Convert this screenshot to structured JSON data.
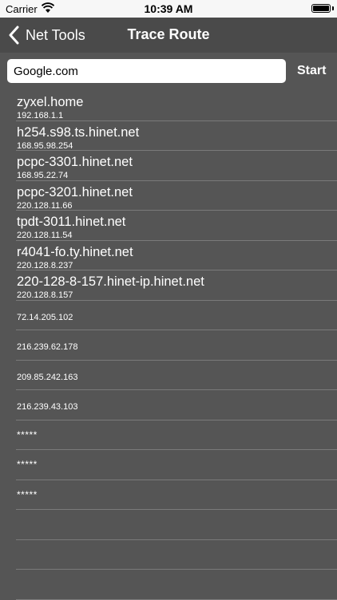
{
  "status_bar": {
    "carrier": "Carrier",
    "time": "10:39 AM"
  },
  "nav": {
    "back_label": "Net Tools",
    "title": "Trace Route"
  },
  "search": {
    "value": "Google.com",
    "start_label": "Start"
  },
  "hops": [
    {
      "host": "zyxel.home",
      "ip": "192.168.1.1"
    },
    {
      "host": "h254.s98.ts.hinet.net",
      "ip": "168.95.98.254"
    },
    {
      "host": "pcpc-3301.hinet.net",
      "ip": "168.95.22.74"
    },
    {
      "host": "pcpc-3201.hinet.net",
      "ip": "220.128.11.66"
    },
    {
      "host": "tpdt-3011.hinet.net",
      "ip": "220.128.11.54"
    },
    {
      "host": "r4041-fo.ty.hinet.net",
      "ip": "220.128.8.237"
    },
    {
      "host": "220-128-8-157.hinet-ip.hinet.net",
      "ip": "220.128.8.157"
    },
    {
      "host": "",
      "ip": "72.14.205.102"
    },
    {
      "host": "",
      "ip": "216.239.62.178"
    },
    {
      "host": "",
      "ip": "209.85.242.163"
    },
    {
      "host": "",
      "ip": "216.239.43.103"
    },
    {
      "host": "",
      "ip": "*****"
    },
    {
      "host": "",
      "ip": "*****"
    },
    {
      "host": "",
      "ip": "*****"
    },
    {
      "host": "",
      "ip": ""
    },
    {
      "host": "",
      "ip": ""
    },
    {
      "host": "",
      "ip": ""
    }
  ]
}
